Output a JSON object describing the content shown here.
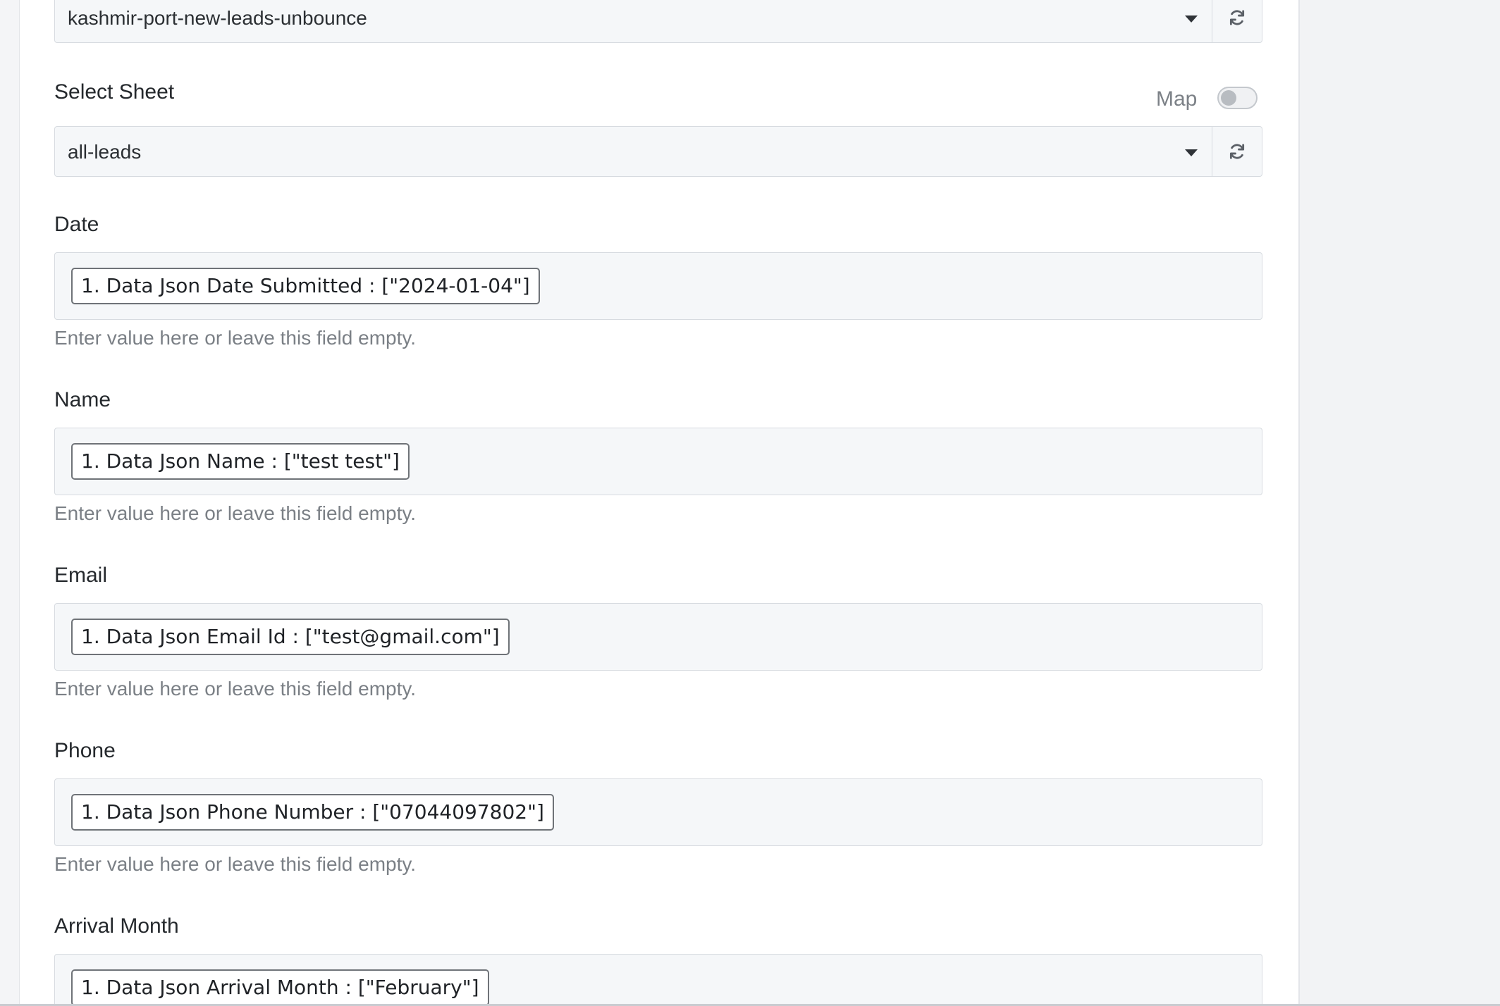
{
  "spreadsheet_select": {
    "value": "kashmir-port-new-leads-unbounce"
  },
  "sheet_select": {
    "label": "Select Sheet",
    "value": "all-leads",
    "map_label": "Map",
    "map_enabled": false
  },
  "fields": [
    {
      "label": "Date",
      "chip": "1. Data Json Date Submitted : [\"2024-01-04\"]",
      "hint": "Enter value here or leave this field empty."
    },
    {
      "label": "Name",
      "chip": "1. Data Json Name : [\"test test\"]",
      "hint": "Enter value here or leave this field empty."
    },
    {
      "label": "Email",
      "chip": "1. Data Json Email Id : [\"test@gmail.com\"]",
      "hint": "Enter value here or leave this field empty."
    },
    {
      "label": "Phone",
      "chip": "1. Data Json Phone Number : [\"07044097802\"]",
      "hint": "Enter value here or leave this field empty."
    },
    {
      "label": "Arrival Month",
      "chip": "1. Data Json Arrival Month : [\"February\"]"
    }
  ],
  "icons": {
    "refresh": "refresh-icon",
    "dropdown": "caret-down-icon"
  }
}
